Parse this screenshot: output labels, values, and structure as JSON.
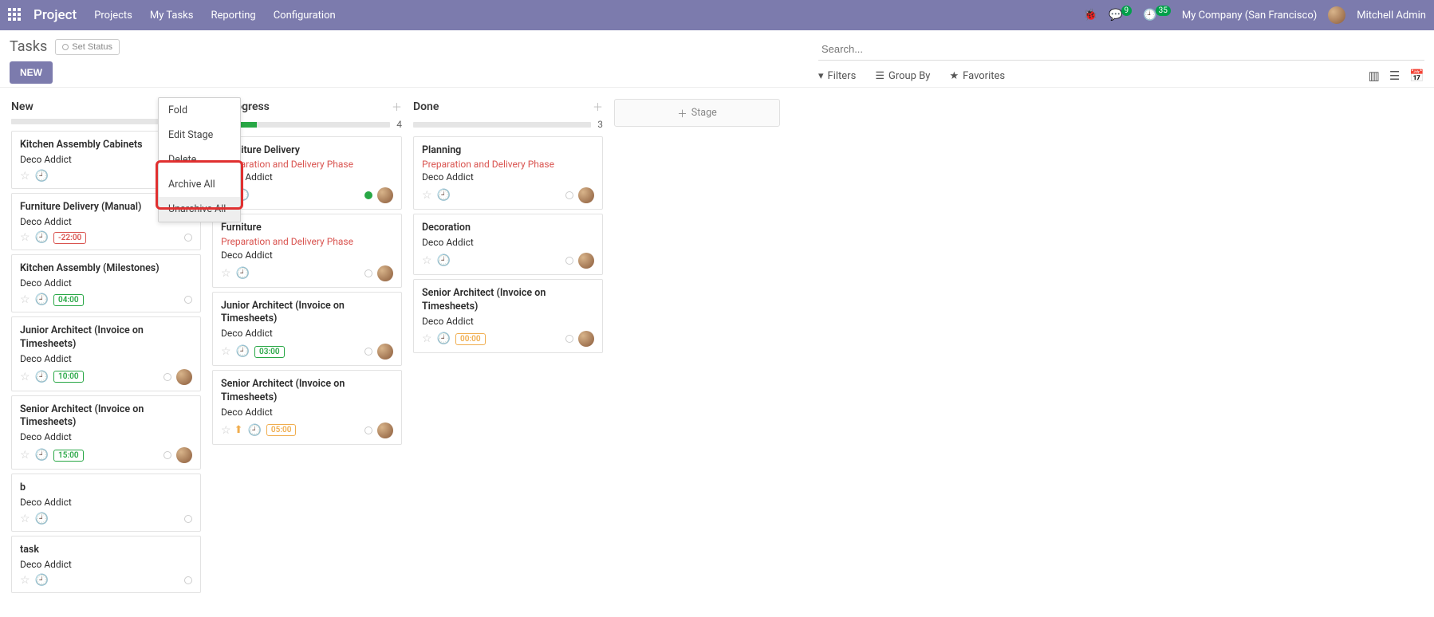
{
  "topbar": {
    "brand": "Project",
    "nav": [
      "Projects",
      "My Tasks",
      "Reporting",
      "Configuration"
    ],
    "messages_badge": "9",
    "activities_badge": "35",
    "company": "My Company (San Francisco)",
    "user": "Mitchell Admin"
  },
  "subbar": {
    "title": "Tasks",
    "status_label": "Set Status",
    "new_label": "NEW",
    "search_placeholder": "Search...",
    "filters_label": "Filters",
    "groupby_label": "Group By",
    "favorites_label": "Favorites"
  },
  "context_menu": {
    "items": [
      "Fold",
      "Edit Stage",
      "Delete",
      "Archive All",
      "Unarchive All"
    ]
  },
  "add_stage_label": "Stage",
  "columns": [
    {
      "title": "New",
      "count": "",
      "progress_green_pct": 0,
      "cards": [
        {
          "title": "Kitchen Assembly Cabinets",
          "company": "Deco Addict"
        },
        {
          "title": "Furniture Delivery (Manual)",
          "company": "Deco Addict",
          "time": "-22:00",
          "time_class": "time-red"
        },
        {
          "title": "Kitchen Assembly (Milestones)",
          "company": "Deco Addict",
          "time": "04:00",
          "time_class": "time-green"
        },
        {
          "title": "Junior Architect (Invoice on Timesheets)",
          "company": "Deco Addict",
          "time": "10:00",
          "time_class": "time-green",
          "avatar": true
        },
        {
          "title": "Senior Architect (Invoice on Timesheets)",
          "company": "Deco Addict",
          "time": "15:00",
          "time_class": "time-green",
          "avatar": true
        },
        {
          "title": "b",
          "company": "Deco Addict"
        },
        {
          "title": "task",
          "company": "Deco Addict"
        }
      ]
    },
    {
      "title": "In Progress",
      "count": "4",
      "progress_green_pct": 25,
      "cards": [
        {
          "title": "Furniture Delivery",
          "phase": "Preparation and Delivery Phase",
          "company": "Deco Addict",
          "status": "green",
          "avatar": true
        },
        {
          "title": "Furniture",
          "phase": "Preparation and Delivery Phase",
          "company": "Deco Addict",
          "avatar": true
        },
        {
          "title": "Junior Architect (Invoice on Timesheets)",
          "company": "Deco Addict",
          "time": "03:00",
          "time_class": "time-green",
          "avatar": true
        },
        {
          "title": "Senior Architect (Invoice on Timesheets)",
          "company": "Deco Addict",
          "time": "05:00",
          "time_class": "time-orange",
          "upload": true,
          "avatar": true
        }
      ]
    },
    {
      "title": "Done",
      "count": "3",
      "progress_green_pct": 0,
      "cards": [
        {
          "title": "Planning",
          "phase": "Preparation and Delivery Phase",
          "company": "Deco Addict",
          "avatar": true
        },
        {
          "title": "Decoration",
          "company": "Deco Addict",
          "avatar": true
        },
        {
          "title": "Senior Architect (Invoice on Timesheets)",
          "company": "Deco Addict",
          "time": "00:00",
          "time_class": "time-orange",
          "avatar": true
        }
      ]
    }
  ]
}
